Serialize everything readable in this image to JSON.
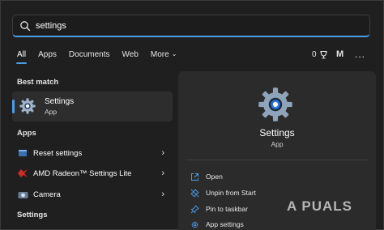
{
  "search": {
    "value": "settings"
  },
  "tabs": [
    {
      "label": "All"
    },
    {
      "label": "Apps"
    },
    {
      "label": "Documents"
    },
    {
      "label": "Web"
    },
    {
      "label": "More"
    }
  ],
  "header_right": {
    "points": "0",
    "avatar": "M",
    "more": "..."
  },
  "best_match": {
    "heading": "Best match",
    "name": "Settings",
    "type": "App"
  },
  "apps": {
    "heading": "Apps",
    "items": [
      {
        "label": "Reset settings"
      },
      {
        "label": "AMD Radeon™ Settings Lite"
      },
      {
        "label": "Camera"
      }
    ]
  },
  "settings_section": {
    "heading": "Settings"
  },
  "details": {
    "title": "Settings",
    "subtitle": "App",
    "actions": [
      {
        "label": "Open"
      },
      {
        "label": "Unpin from Start"
      },
      {
        "label": "Pin to taskbar"
      },
      {
        "label": "App settings"
      }
    ]
  },
  "watermark": "A PUALS",
  "colors": {
    "accent": "#4a9ee8",
    "background": "#1f1f1f",
    "panel": "#2b2b2b"
  }
}
